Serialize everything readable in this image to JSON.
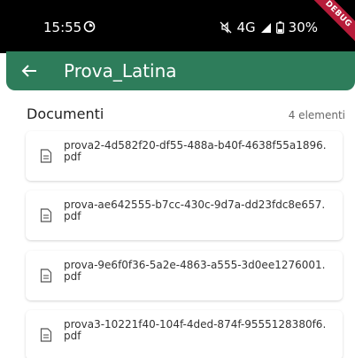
{
  "status_bar": {
    "time": "15:55",
    "network": "4G",
    "battery": "30%",
    "debug_label": "DEBUG",
    "icons": [
      "sync-icon",
      "mute-icon",
      "signal-icon",
      "battery-icon"
    ]
  },
  "app_bar": {
    "title": "Prova_Latina",
    "back_icon": "arrow-left-icon",
    "color": "#2e7d5b"
  },
  "documents": {
    "title": "Documenti",
    "count": "4 elementi",
    "items": [
      {
        "name": "prova2-4d582f20-df55-488a-b40f-4638f55a1896.pdf"
      },
      {
        "name": "prova-ae642555-b7cc-430c-9d7a-dd23fdc8e657.pdf"
      },
      {
        "name": "prova-9e6f0f36-5a2e-4863-a555-3d0ee1276001.pdf"
      },
      {
        "name": "prova3-10221f40-104f-4ded-874f-9555128380f6.pdf"
      }
    ]
  }
}
